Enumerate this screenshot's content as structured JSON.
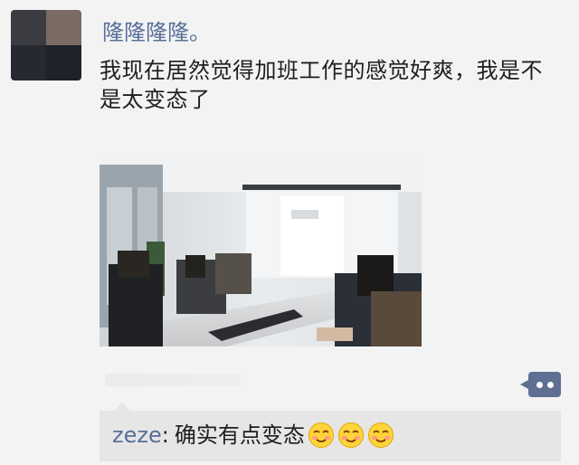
{
  "post": {
    "author": "隆隆隆隆。",
    "text": "我现在居然觉得加班工作的感觉好爽，我是不是太变态了",
    "image_alt": "blurred office meeting room photo"
  },
  "actions": {
    "more_icon": "ellipsis-icon"
  },
  "comments": [
    {
      "author": "zeze",
      "separator": ":",
      "text": "确实有点变态",
      "emojis": [
        "blushing-smile-icon",
        "blushing-smile-icon",
        "blushing-smile-icon"
      ]
    }
  ]
}
